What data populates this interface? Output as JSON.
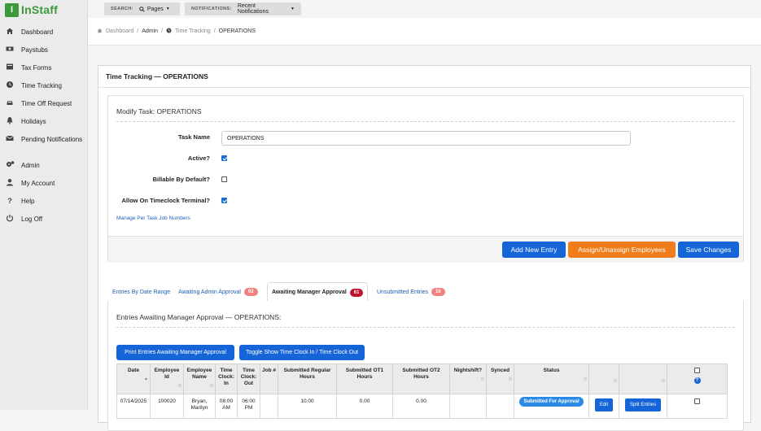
{
  "app": {
    "logo_text": "InStaff",
    "logo_letter": "I"
  },
  "topbar": {
    "search_caption": "SEARCH:",
    "search_value": "Pages",
    "notifications_caption": "NOTIFICATIONS:",
    "notifications_value": "Recent Notifications"
  },
  "sidebar": {
    "items": [
      {
        "label": "Dashboard",
        "icon": "home-icon"
      },
      {
        "label": "Paystubs",
        "icon": "money-icon"
      },
      {
        "label": "Tax Forms",
        "icon": "form-icon"
      },
      {
        "label": "Time Tracking",
        "icon": "clock-icon"
      },
      {
        "label": "Time Off Request",
        "icon": "car-icon"
      },
      {
        "label": "Holidays",
        "icon": "bell-icon"
      },
      {
        "label": "Pending Notifications",
        "icon": "envelope-icon"
      },
      {
        "label": "Admin",
        "icon": "cogs-icon"
      },
      {
        "label": "My Account",
        "icon": "user-icon"
      },
      {
        "label": "Help",
        "icon": "question-icon"
      },
      {
        "label": "Log Off",
        "icon": "power-icon"
      }
    ]
  },
  "breadcrumb": {
    "dashboard": "Dashboard",
    "admin": "Admin",
    "time_tracking": "Time Tracking",
    "current": "OPERATIONS",
    "sep": "/"
  },
  "panel": {
    "title": "Time Tracking — OPERATIONS"
  },
  "modify": {
    "title": "Modify Task: OPERATIONS",
    "task_name_label": "Task Name",
    "task_name_value": "OPERATIONS",
    "active_label": "Active?",
    "billable_label": "Billable By Default?",
    "allow_label": "Allow On Timeclock Terminal?",
    "manage_link": "Manage Per Task Job Numbers",
    "btn_add": "Add New Entry",
    "btn_assign": "Assign/Unassign Employees",
    "btn_save": "Save Changes"
  },
  "tabs": {
    "date_range": "Entries By Date Range",
    "admin": "Awaiting Admin Approval",
    "admin_count": "92",
    "manager": "Awaiting Manager Approval",
    "manager_count": "61",
    "unsubmitted": "Unsubmitted Entries",
    "unsubmitted_count": "10"
  },
  "awaiting": {
    "title": "Entries Awaiting Manager Approval — OPERATIONS:",
    "btn_print": "Print Entries Awaiting Manager Approval",
    "btn_toggle": "Toggle Show Time Clock In / Time Clock Out",
    "columns": {
      "date": "Date",
      "employee_id": "Employee Id",
      "employee_name": "Employee Name",
      "clock_in": "Time Clock: In",
      "clock_out": "Time Clock: Out",
      "job": "Job #",
      "reg": "Submitted Regular Hours",
      "ot1": "Submitted OT1 Hours",
      "ot2": "Submitted OT2 Hours",
      "night": "Nightshift?",
      "synced": "Synced",
      "status": "Status"
    },
    "rows": [
      {
        "date": "07/14/2025",
        "employee_id": "100020",
        "employee_name": "Bryan, Marilyn",
        "clock_in": "08:00 AM",
        "clock_out": "06:00 PM",
        "job": "",
        "reg": "10.00",
        "ot1": "0.00",
        "ot2": "0.00",
        "night": "",
        "synced": "",
        "status": "Submitted For Approval",
        "edit": "Edit",
        "split": "Split Entries"
      }
    ]
  }
}
